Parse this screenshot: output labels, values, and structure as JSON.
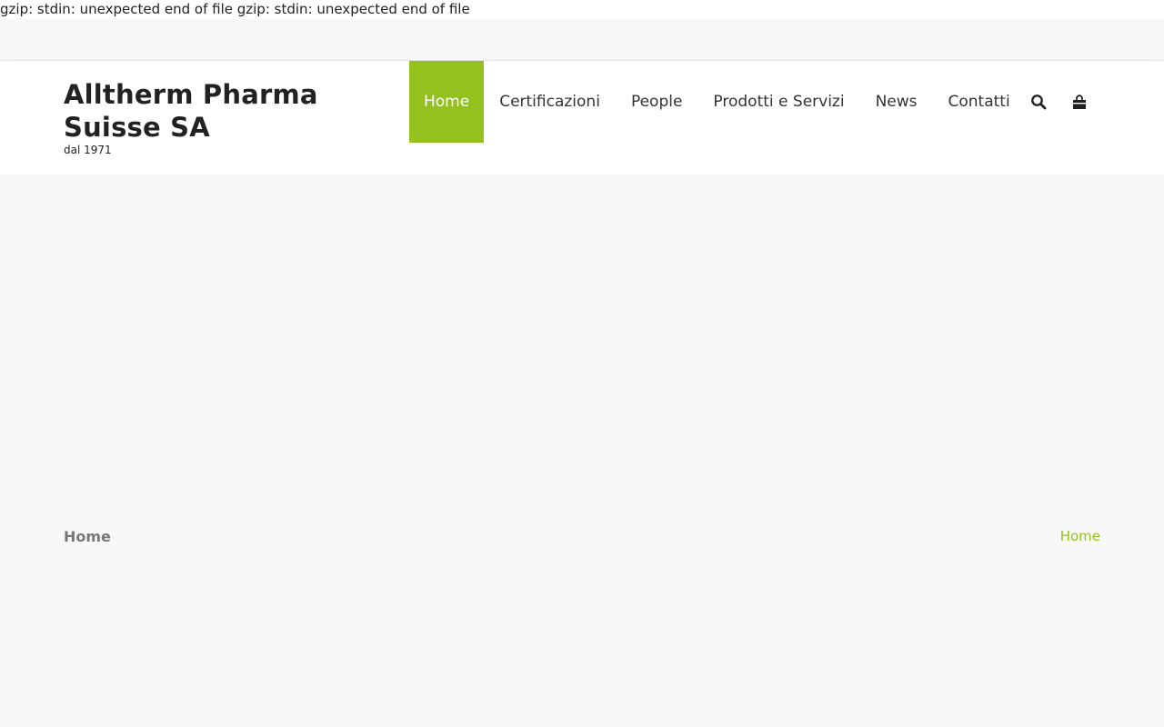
{
  "error_text": "gzip: stdin: unexpected end of file gzip: stdin: unexpected end of file",
  "brand": {
    "title": "Alltherm Pharma Suisse SA",
    "tagline": "dal 1971"
  },
  "nav": {
    "items": [
      {
        "label": "Home"
      },
      {
        "label": "Certificazioni"
      },
      {
        "label": "People"
      },
      {
        "label": "Prodotti e Servizi"
      },
      {
        "label": "News"
      },
      {
        "label": "Contatti"
      }
    ]
  },
  "icons": {
    "search": "search-icon",
    "cart": "shopping-bag-icon"
  },
  "page": {
    "title": "Home",
    "breadcrumb": "Home"
  },
  "colors": {
    "accent": "#95c11f",
    "text": "#222222",
    "muted": "#777777",
    "background": "#f7f7f7"
  }
}
